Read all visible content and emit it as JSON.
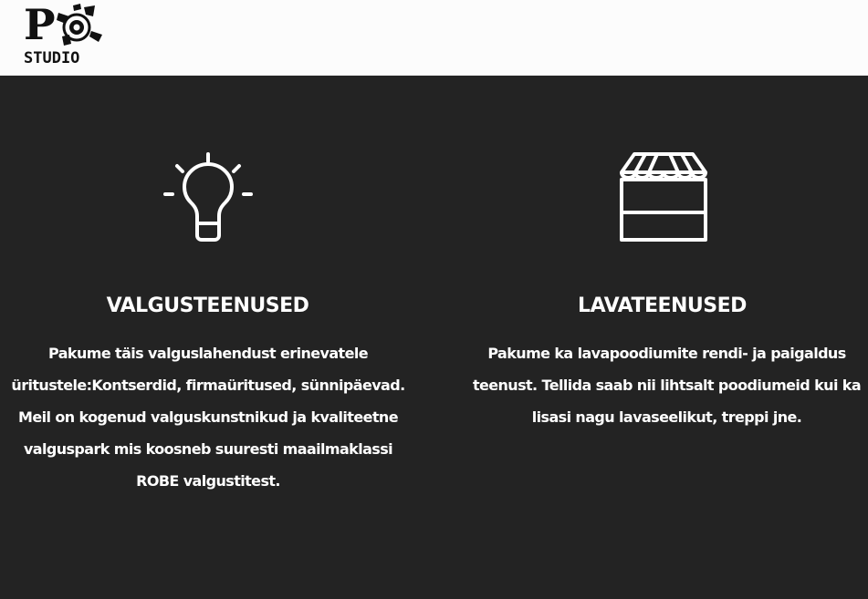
{
  "header": {
    "logo": {
      "letter": "P",
      "wordmark": "STUDIO",
      "icon": "stage-spotlight-icon"
    }
  },
  "services": [
    {
      "icon": "lightbulb-icon",
      "title": "VALGUSTEENUSED",
      "text": "Pakume täis valguslahendust erinevatele üritustele:Kontserdid, firmaüritused, sünnipäevad. Meil on kogenud valguskunstnikud ja kvaliteetne valguspark mis koosneb suuresti maailmaklassi ROBE valgustitest."
    },
    {
      "icon": "storefront-awning-icon",
      "title": "LAVATEENUSED",
      "text": "Pakume ka lavapoodiumite rendi- ja paigaldus teenust. Tellida saab nii lihtsalt poodiumeid kui ka lisasi nagu lavaseelikut, treppi jne."
    }
  ],
  "colors": {
    "header_bg": "#fcfcfc",
    "page_bg": "#232323",
    "text": "#ffffff",
    "logo": "#111111"
  }
}
